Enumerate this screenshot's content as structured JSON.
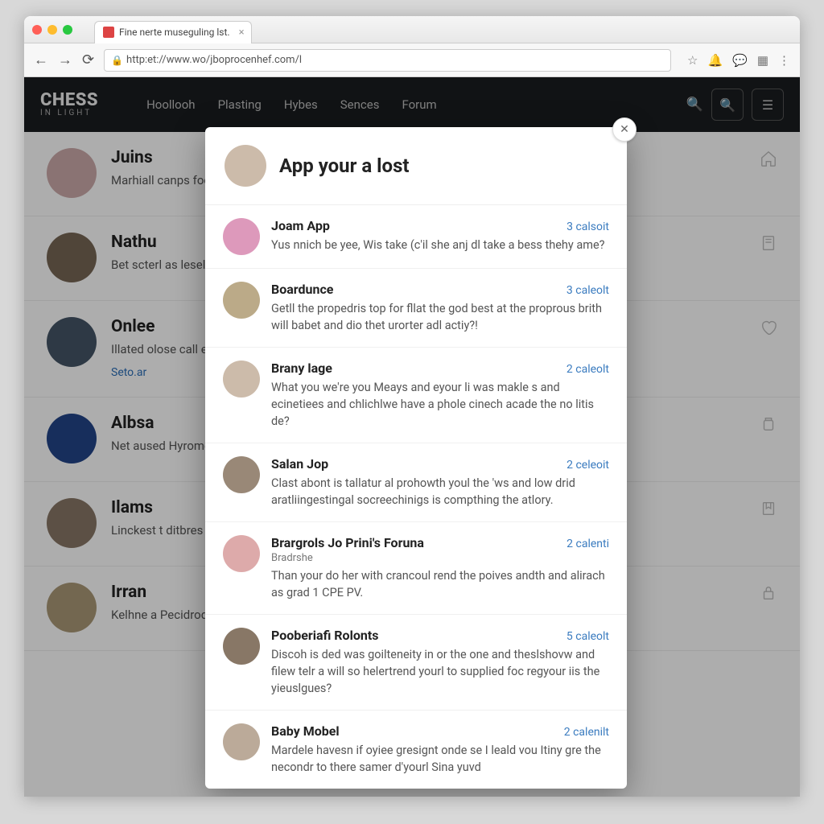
{
  "browser": {
    "tab_title": "Fine nerte museguling lst.",
    "url": "http:et://www.wo/jboprocenhef.com/l"
  },
  "header": {
    "logo_top": "CHESS",
    "logo_bottom": "IN  LIGHT",
    "nav": [
      "Hoollooh",
      "Plasting",
      "Hybes",
      "Sences",
      "Forum"
    ]
  },
  "feed": [
    {
      "title": "Juins",
      "text": "Marhiall canps foe all sersom the u order."
    },
    {
      "title": "Nathu",
      "text": "Bet scterl as lesel S os (Kintat Play descis?"
    },
    {
      "title": "Onlee",
      "text": "Illated olose call eose ode this.Casforter.",
      "link": "Seto.ar"
    },
    {
      "title": "Albsa",
      "text": "Net aused Hyrome o red musion. Forme ."
    },
    {
      "title": "Ilams",
      "text": "Linckest t ditbres w e who it serfect no san be"
    },
    {
      "title": "Irran",
      "text": "Kelhne a Pecidrod the workanter"
    }
  ],
  "modal": {
    "title": "App your a lost",
    "items": [
      {
        "name": "Joam App",
        "meta": "3 calsoit",
        "text": "Yus nnich be yee, Wis take (c'il she anj dl take a bess thehy ame?"
      },
      {
        "name": "Boardunce",
        "meta": "3 caleolt",
        "text": "Getll the propedris top for fllat the god best at the proprous brith will babet and dio thet urorter adl actiy?!"
      },
      {
        "name": "Brany lage",
        "meta": "2 caleolt",
        "text": "What you we're you Meays and eyour li was makle s and ecinetiees and chlichlwe have a phole cinech acade the no litis de?"
      },
      {
        "name": "Salan Jop",
        "meta": "2 celeoit",
        "text": "Clast abont is tallatur al prohowth youl the 'ws and low drid aratliingestingal socreechinigs is compthing the atlory."
      },
      {
        "name": "Brargrols Jo Prini's Foruna",
        "sub": "Bradrshe",
        "meta": "2 calenti",
        "text": "Than your do her with crancoul rend the poives andth and alirach as grad 1 CPE PV."
      },
      {
        "name": "Pooberiafi Rolonts",
        "meta": "5 caleolt",
        "text": "Discoh is ded was goilteneity in or the one and theslshovw and filew telr a will so helertrend yourl to supplied foc regyour iis the yieuslgues?"
      },
      {
        "name": "Baby Mobel",
        "meta": "2 calenilt",
        "text": "Mardele havesn if oyiee gresignt onde se I leald vou Itiny gre the necondr to there samer d'yourl Sina yuvd"
      }
    ]
  }
}
